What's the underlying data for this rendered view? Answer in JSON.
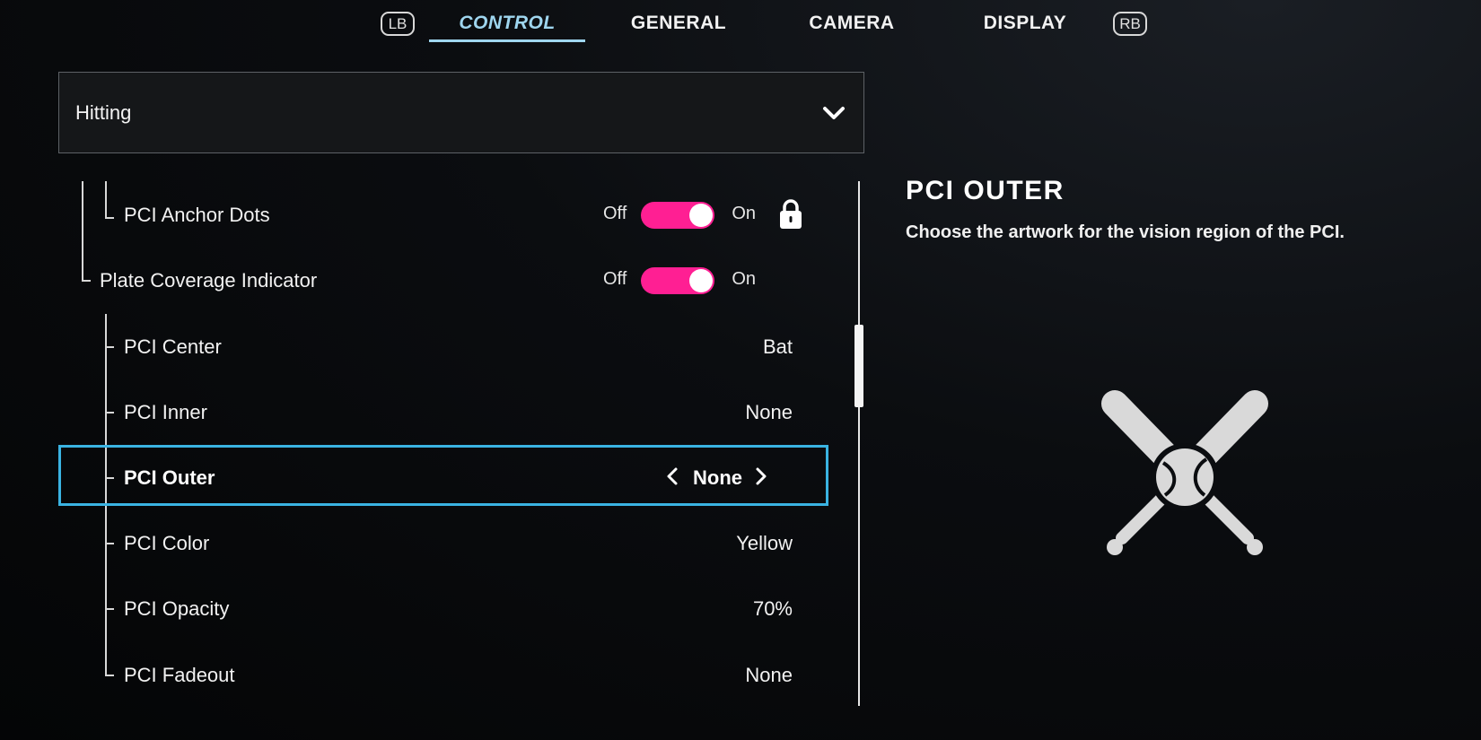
{
  "nav": {
    "left_bumper": "LB",
    "right_bumper": "RB",
    "tabs": [
      {
        "label": "CONTROL",
        "active": true
      },
      {
        "label": "GENERAL",
        "active": false
      },
      {
        "label": "CAMERA",
        "active": false
      },
      {
        "label": "DISPLAY",
        "active": false
      }
    ]
  },
  "category_dropdown": {
    "value": "Hitting"
  },
  "settings": [
    {
      "label": "PCI Anchor Dots",
      "type": "toggle",
      "off_label": "Off",
      "on_label": "On",
      "state": "On",
      "locked": true
    },
    {
      "label": "Plate Coverage Indicator",
      "type": "toggle",
      "off_label": "Off",
      "on_label": "On",
      "state": "On"
    },
    {
      "label": "PCI Center",
      "type": "value",
      "value": "Bat"
    },
    {
      "label": "PCI Inner",
      "type": "value",
      "value": "None"
    },
    {
      "label": "PCI Outer",
      "type": "selector",
      "value": "None",
      "selected": true
    },
    {
      "label": "PCI Color",
      "type": "value",
      "value": "Yellow"
    },
    {
      "label": "PCI Opacity",
      "type": "value",
      "value": "70%"
    },
    {
      "label": "PCI Fadeout",
      "type": "value",
      "value": "None"
    }
  ],
  "detail": {
    "title": "PCI OUTER",
    "description": "Choose the artwork for the vision region of the PCI.",
    "artwork_icon": "crossed-bats-ball-icon"
  },
  "colors": {
    "accent_tab": "#9fd6ef",
    "toggle_on": "#ff1f93",
    "selection_border": "#3ab3e2"
  }
}
